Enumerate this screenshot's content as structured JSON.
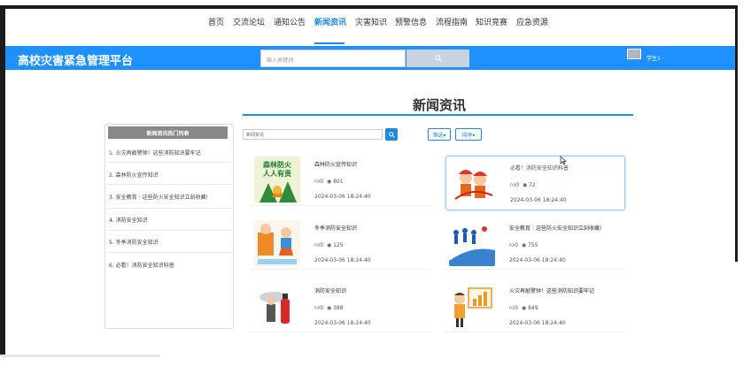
{
  "nav": {
    "items": [
      "首页",
      "交流论坛",
      "通知公告",
      "新闻资讯",
      "灾害知识",
      "预警信息",
      "流程指南",
      "知识竞赛",
      "应急资源"
    ],
    "active_index": 3
  },
  "header": {
    "brand": "高校灾害紧急管理平台",
    "search_placeholder": "输入关键词",
    "user": "学生1 ·"
  },
  "page": {
    "title": "新闻资讯"
  },
  "sidebar": {
    "heading": "新闻资讯热门列表",
    "items": [
      "1. 火灾再敲警钟！这些消防知识要牢记",
      "2. 森林防火宣传知识",
      "3. 安全教育｜这些防火安全知识立刻收藏!",
      "4. 消防安全知识",
      "5. 冬季消防安全知识",
      "6. 必看！消防安全知识科普"
    ]
  },
  "filters": {
    "search_placeholder": "新闻资讯",
    "filter_label": "筛选▾",
    "sort_label": "排序▾"
  },
  "cards": [
    {
      "title": "森林防火宣传知识",
      "likes": "0",
      "views": "801",
      "date": "2024-03-06 18:24:40",
      "thumb": "forest-fire-poster"
    },
    {
      "title": "必看！消防安全知识科普",
      "likes": "0",
      "views": "72",
      "date": "2024-03-06 18:24:40",
      "thumb": "firefighters-cartoon"
    },
    {
      "title": "冬季消防安全知识",
      "likes": "0",
      "views": "125",
      "date": "2024-03-06 18:24:40",
      "thumb": "winter-fire-cartoon"
    },
    {
      "title": "安全教育｜这些防火安全知识立刻收藏!",
      "likes": "0",
      "views": "755",
      "date": "2024-03-06 18:24:40",
      "thumb": "evacuation-figures"
    },
    {
      "title": "消防安全知识",
      "likes": "0",
      "views": "388",
      "date": "2024-03-06 18:24:40",
      "thumb": "fire-extinguisher"
    },
    {
      "title": "火灾再敲警钟！这些消防知识要牢记",
      "likes": "0",
      "views": "849",
      "date": "2024-03-06 18:24:40",
      "thumb": "presenter-chart"
    }
  ],
  "poster_text": {
    "line1": "森林防火",
    "line2": "人人有责"
  },
  "colors": {
    "accent": "#1e90ff",
    "highlight_border": "#9ec8ef"
  }
}
